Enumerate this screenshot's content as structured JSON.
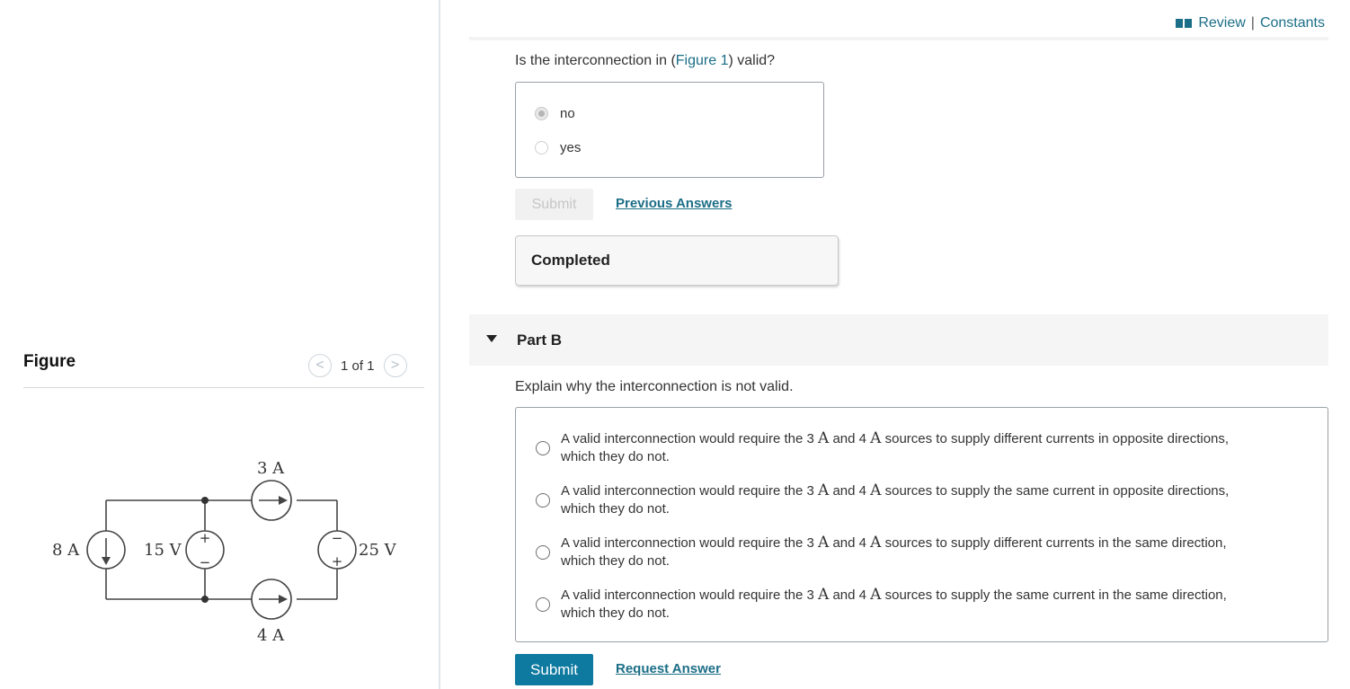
{
  "header": {
    "review": "Review",
    "separator": "|",
    "constants": "Constants"
  },
  "figure_panel": {
    "title": "Figure",
    "page_count": "1 of 1",
    "prev_label": "<",
    "next_label": ">",
    "labels": {
      "i8": "8 A",
      "v15": "15 V",
      "i3": "3 A",
      "i4": "4 A",
      "v25": "25 V",
      "plus": "+",
      "minus": "−"
    }
  },
  "part_a": {
    "question_prefix": "Is the interconnection in (",
    "figure_link": "Figure 1",
    "question_suffix": ") valid?",
    "options": [
      {
        "label": "no",
        "selected": true
      },
      {
        "label": "yes",
        "selected": false
      }
    ],
    "submit_label": "Submit",
    "previous_answers_label": "Previous Answers",
    "status": "Completed"
  },
  "part_b": {
    "title": "Part B",
    "prompt": "Explain why the interconnection is not valid.",
    "options": [
      {
        "pre": "A valid interconnection would require the 3 ",
        "unit1": "A",
        "mid": " and 4 ",
        "unit2": "A",
        "post": " sources to supply different currents in opposite directions,",
        "line2": "which they do not."
      },
      {
        "pre": "A valid interconnection would require the 3 ",
        "unit1": "A",
        "mid": " and 4 ",
        "unit2": "A",
        "post": " sources to supply the same current in opposite directions,",
        "line2": "which they do not."
      },
      {
        "pre": "A valid interconnection would require the 3 ",
        "unit1": "A",
        "mid": " and 4 ",
        "unit2": "A",
        "post": " sources to supply different currents in the same direction,",
        "line2": "which they do not."
      },
      {
        "pre": "A valid interconnection would require the 3 ",
        "unit1": "A",
        "mid": " and 4 ",
        "unit2": "A",
        "post": " sources to supply the same current in the same direction,",
        "line2": "which they do not."
      }
    ],
    "submit_label": "Submit",
    "request_answer_label": "Request Answer"
  },
  "colors": {
    "link": "#1b6e87",
    "submit_bg": "#0f7aa0"
  }
}
